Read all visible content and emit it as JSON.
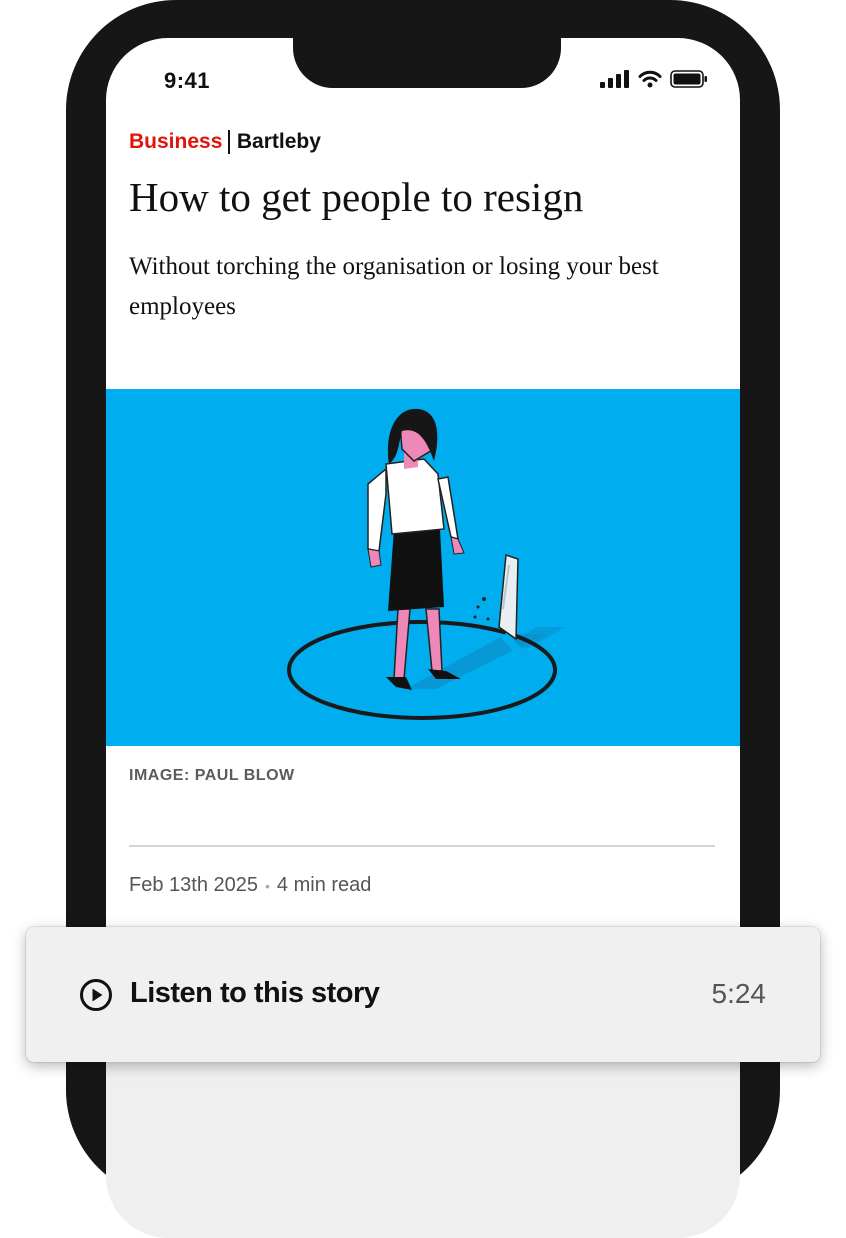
{
  "status_bar": {
    "time": "9:41"
  },
  "article": {
    "section": "Business",
    "column": "Bartleby",
    "headline": "How to get people to resign",
    "standfirst": "Without torching the organisation or losing your best employees",
    "image_caption": "IMAGE: PAUL BLOW",
    "date": "Feb 13th 2025",
    "read_time": "4 min read"
  },
  "audio": {
    "label": "Listen to this story",
    "duration": "5:24"
  },
  "colors": {
    "section_red": "#e3120b",
    "hero_blue": "#00adef"
  },
  "icons": [
    "signal-icon",
    "wifi-icon",
    "battery-icon",
    "play-icon"
  ]
}
